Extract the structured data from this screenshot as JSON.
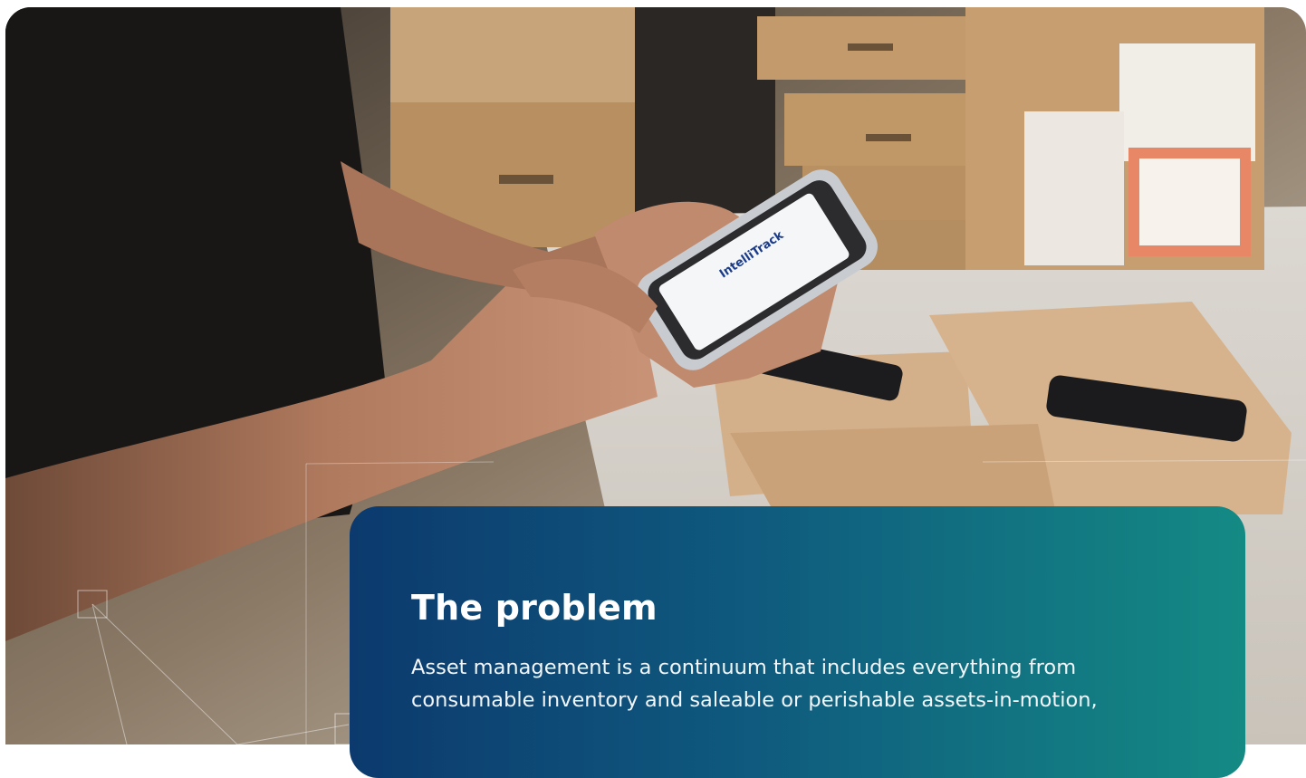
{
  "hero": {
    "device_brand_label": "IntelliTrack"
  },
  "problem_card": {
    "title": "The problem",
    "body": "Asset management is a continuum that includes everything from consumable inventory and saleable or perishable assets-in-motion,"
  },
  "colors": {
    "card_gradient_start": "#0c3a6e",
    "card_gradient_end": "#148a84",
    "text": "#ffffff"
  }
}
